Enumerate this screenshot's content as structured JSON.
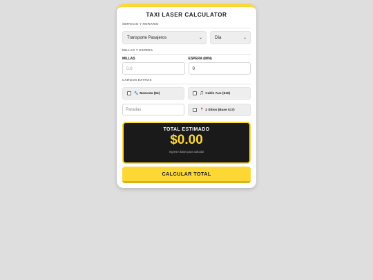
{
  "app": {
    "title": "TAXI LASER CALCULATOR"
  },
  "service": {
    "section_label": "SERVICIO Y HORARIO",
    "service_selected": "Transporte Pasajeros",
    "period_selected": "Día"
  },
  "miles": {
    "section_label": "MILLAS Y ESPERA",
    "miles_label": "MILLAS",
    "miles_placeholder": "0.0",
    "wait_label": "ESPERA (MIN)",
    "wait_value": "0"
  },
  "extras": {
    "section_label": "CARGOS EXTRAS",
    "pet": {
      "icon": "🐾",
      "label": "Mascota ($4)"
    },
    "aux": {
      "icon": "🎵",
      "label": "Cable Aux ($10)"
    },
    "stops_placeholder": "Paradas",
    "two_sites": {
      "icon": "📍",
      "label": "2 Sitios (Base $17)"
    }
  },
  "total": {
    "label": "TOTAL ESTIMADO",
    "amount": "$0.00",
    "hint": "Ingrese datos para calcular"
  },
  "actions": {
    "calculate_label": "CALCULAR TOTAL"
  },
  "colors": {
    "accent": "#fdd835",
    "dark": "#1a1a1a",
    "background": "#dedede"
  },
  "icons": {
    "select_arrow": "chevron-down-icon"
  }
}
